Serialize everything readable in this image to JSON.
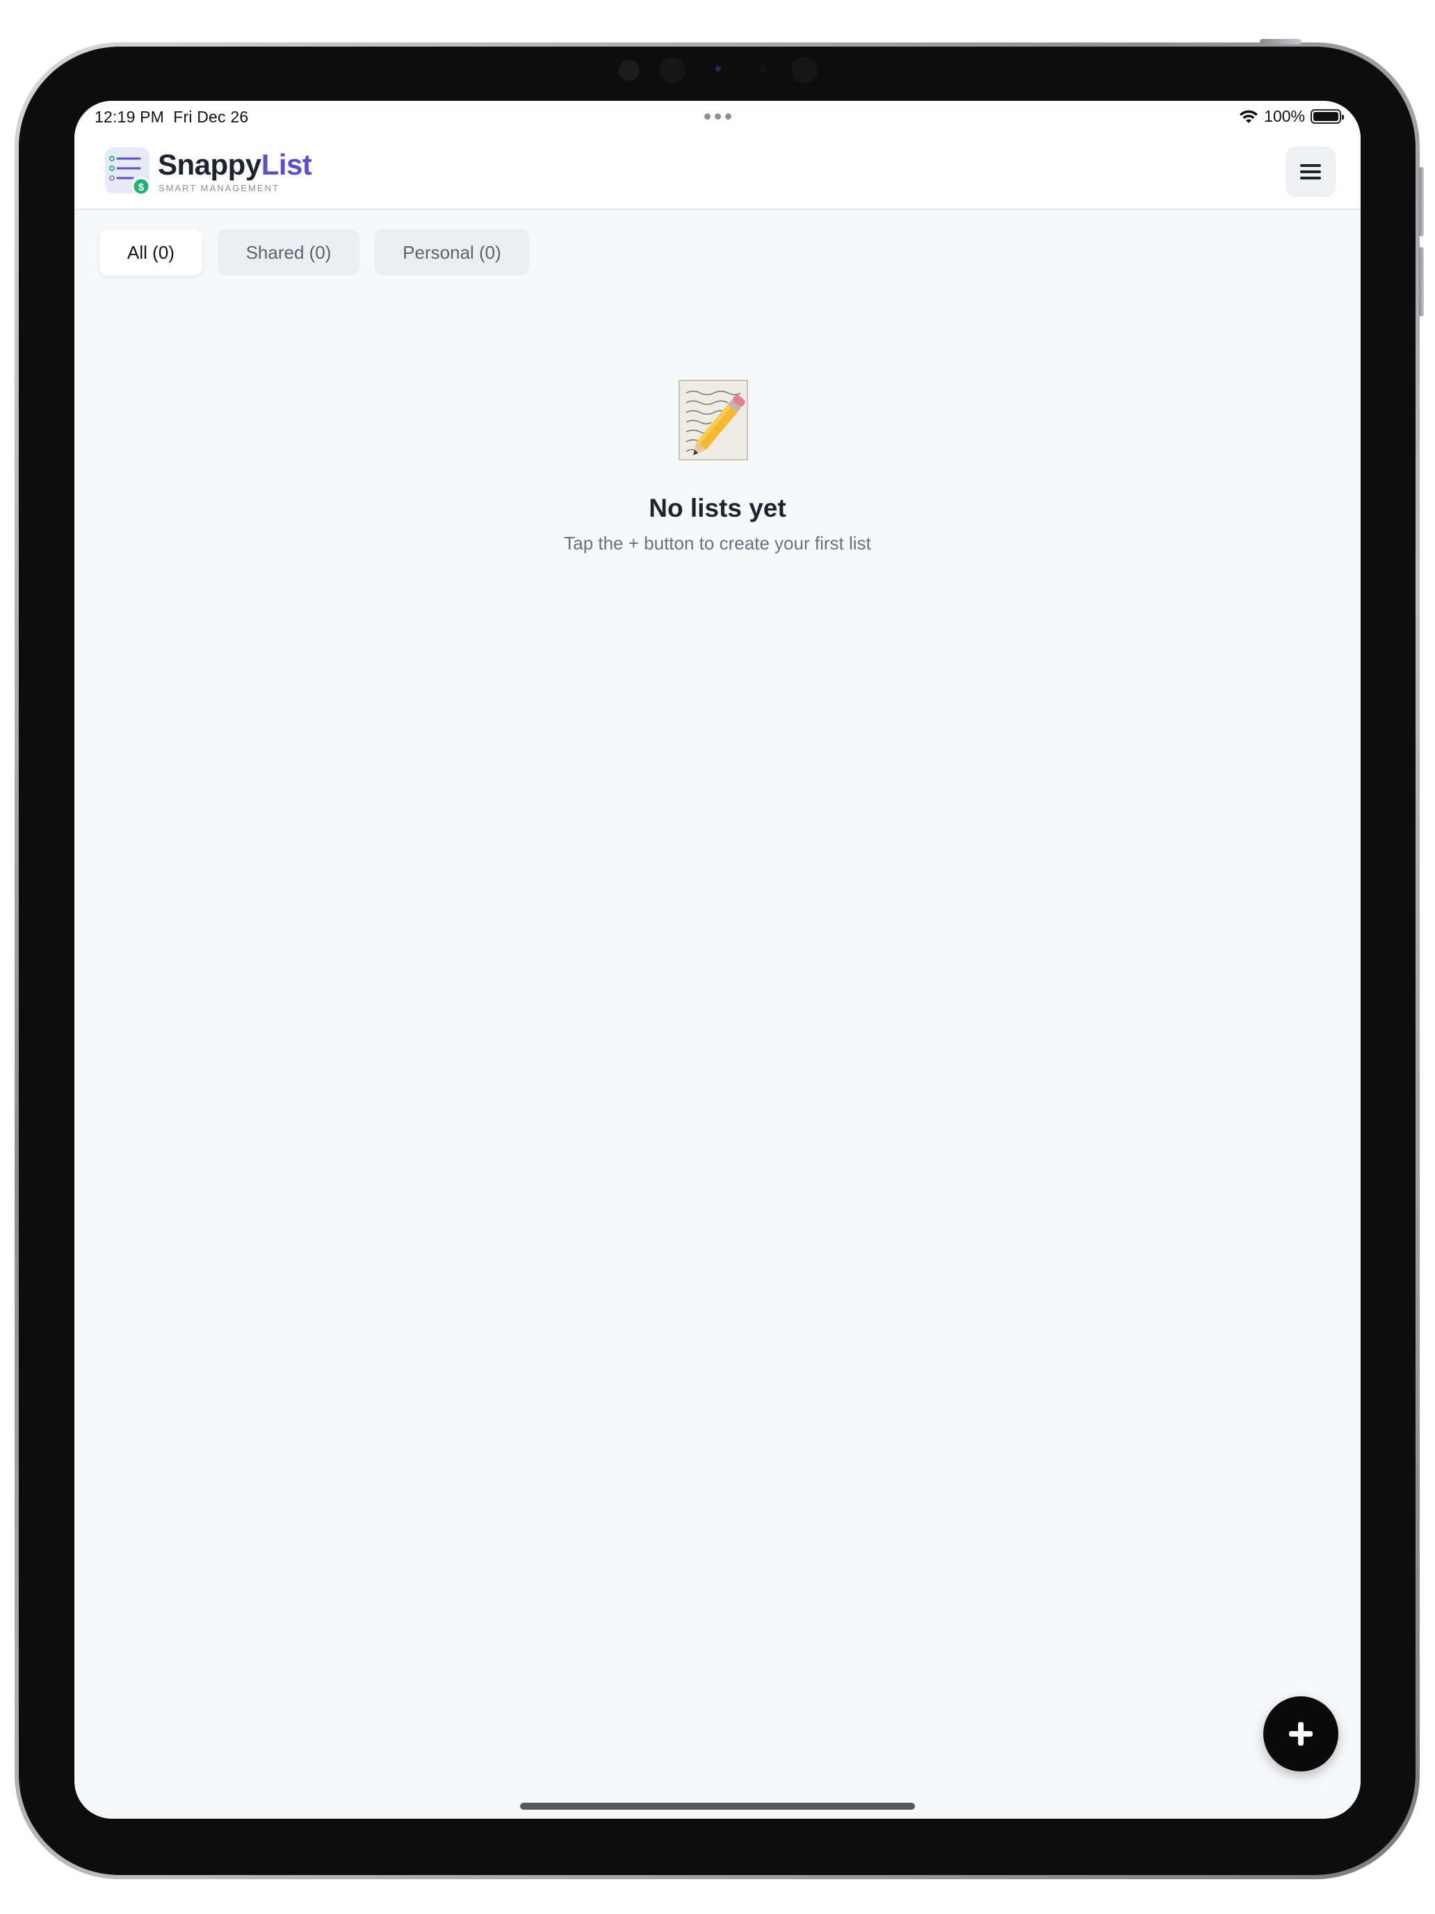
{
  "status_bar": {
    "time": "12:19 PM",
    "date": "Fri Dec 26",
    "battery": "100%",
    "wifi_icon": "wifi-icon",
    "battery_icon": "battery-full-icon"
  },
  "header": {
    "brand_primary": "Snappy",
    "brand_accent": "List",
    "tagline": "SMART MANAGEMENT",
    "menu_icon": "hamburger-menu-icon",
    "accent_color": "#5a4fcf"
  },
  "tabs": [
    {
      "label": "All (0)",
      "active": true
    },
    {
      "label": "Shared (0)",
      "active": false
    },
    {
      "label": "Personal (0)",
      "active": false
    }
  ],
  "empty_state": {
    "icon": "memo-pencil-icon",
    "title": "No lists yet",
    "subtitle": "Tap the + button to create your first list"
  },
  "fab": {
    "icon": "plus-icon"
  }
}
